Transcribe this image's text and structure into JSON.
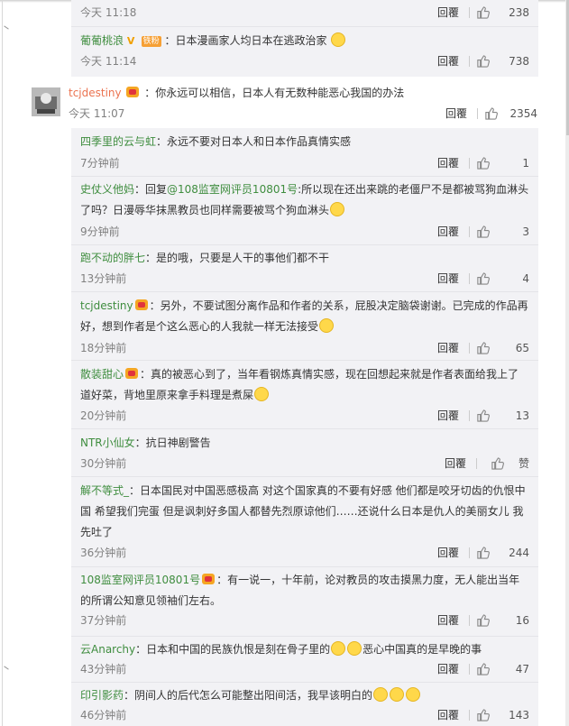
{
  "top_reply": {
    "time": "今天 11:18",
    "reply": "回覆",
    "likes": "238"
  },
  "reply_grape": {
    "user": "葡葡桃浪",
    "tag": "铁粉",
    "text": "：日本漫画家人均日本在逃政治家",
    "time": "今天 11:14",
    "reply": "回覆",
    "likes": "738"
  },
  "main_comment": {
    "user": "tcjdestiny",
    "text": "：你永远可以相信，日本人有无数种能恶心我国的办法",
    "time": "今天 11:07",
    "reply": "回覆",
    "likes": "2354"
  },
  "replies": [
    {
      "user": "四季里的云与虹",
      "text": "：永远不要对日本人和日本作品真情实感",
      "time": "7分钟前",
      "reply": "回覆",
      "likes": "1"
    },
    {
      "user": "史仗义他妈",
      "text_a": "：回复",
      "at": "@108监室网评员10801号",
      "text_b": ":所以现在还出来跳的老僵尸不是都被骂狗血淋头了吗？日漫辱华抹黑教员也同样需要被骂个狗血淋头",
      "time": "9分钟前",
      "reply": "回覆",
      "likes": "3"
    },
    {
      "user": "跑不动的胖七",
      "text": "：是的哦，只要是人干的事他们都不干",
      "time": "13分钟前",
      "reply": "回覆",
      "likes": "4"
    },
    {
      "user": "tcjdestiny",
      "text": "：另外，不要试图分离作品和作者的关系，屁股决定脑袋谢谢。已完成的作品再好，想到作者是个这么恶心的人我就一样无法接受",
      "time": "18分钟前",
      "reply": "回覆",
      "likes": "65"
    },
    {
      "user": "散装甜心",
      "text": "：真的被恶心到了，当年看钢炼真情实感，现在回想起来就是作者表面给我上了道好菜，背地里原来拿手料理是煮屎",
      "time": "20分钟前",
      "reply": "回覆",
      "likes": "13"
    },
    {
      "user": "NTR小仙女",
      "text": "：抗日神剧警告",
      "time": "30分钟前",
      "reply": "回覆",
      "likes": "赞"
    },
    {
      "user": "解不等式_",
      "text": "：日本国民对中国恶感极高 对这个国家真的不要有好感 他们都是咬牙切齿的仇恨中国 希望我们完蛋 但是讽刺好多国人都替先烈原谅他们……还说什么日本是仇人的美丽女儿 我先吐了",
      "time": "36分钟前",
      "reply": "回覆",
      "likes": "244"
    },
    {
      "user": "108监室网评员10801号",
      "text": "：有一说一，十年前，论对教员的攻击摸黑力度，无人能出当年的所谓公知意见领袖们左右。",
      "time": "37分钟前",
      "reply": "回覆",
      "likes": "16"
    },
    {
      "user": "云Anarchy",
      "text_a": "：日本和中国的民族仇恨是刻在骨子里的",
      "text_b": "恶心中国真的是早晚的事",
      "time": "43分钟前",
      "reply": "回覆",
      "likes": "47"
    },
    {
      "user": "印引影药",
      "text": "：阴间人的后代怎么可能整出阳间活，我早该明白的",
      "time": "46分钟前",
      "reply": "回覆",
      "likes": "143"
    }
  ]
}
